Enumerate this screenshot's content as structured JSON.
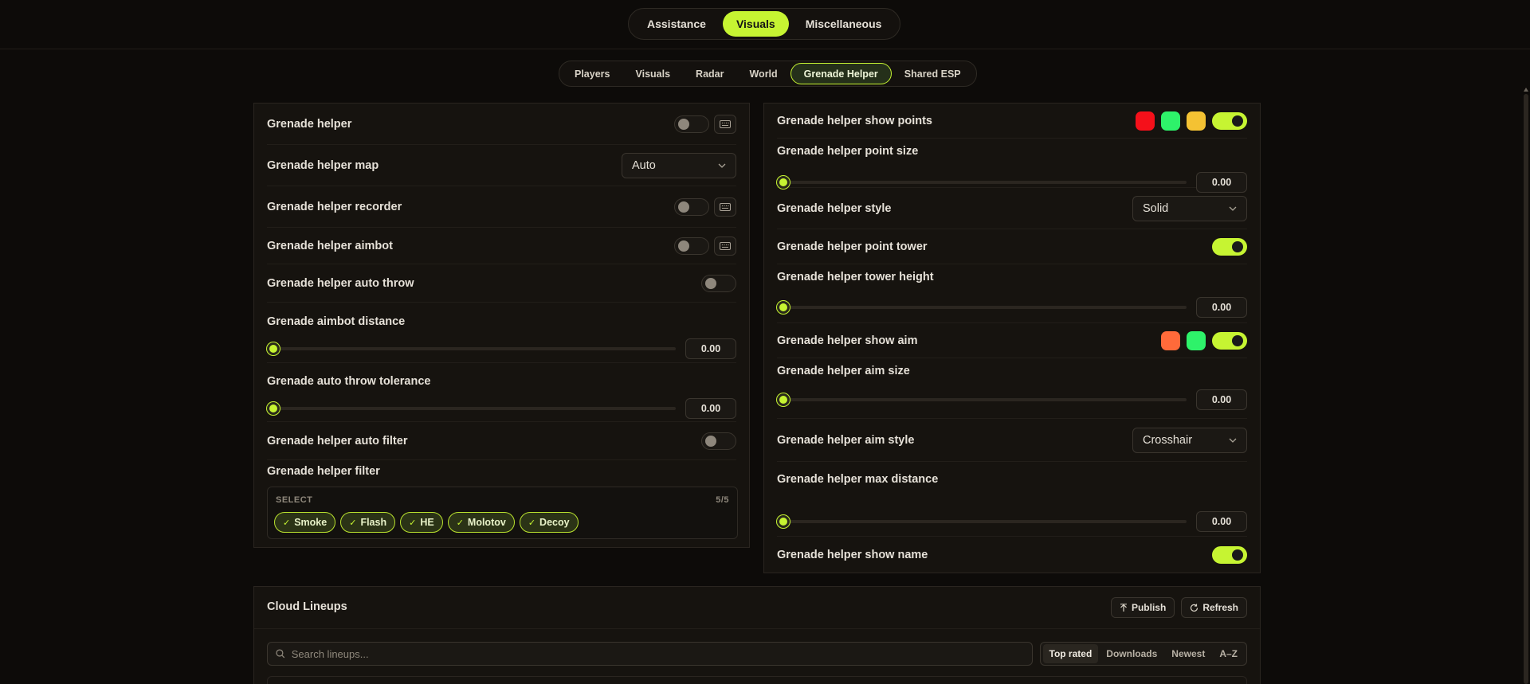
{
  "main_tabs": [
    {
      "label": "Assistance",
      "active": false
    },
    {
      "label": "Visuals",
      "active": true
    },
    {
      "label": "Miscellaneous",
      "active": false
    }
  ],
  "sub_tabs": [
    {
      "label": "Players",
      "active": false
    },
    {
      "label": "Visuals",
      "active": false
    },
    {
      "label": "Radar",
      "active": false
    },
    {
      "label": "World",
      "active": false
    },
    {
      "label": "Grenade Helper",
      "active": true
    },
    {
      "label": "Shared ESP",
      "active": false
    }
  ],
  "left": {
    "helper": {
      "label": "Grenade helper",
      "on": false
    },
    "map": {
      "label": "Grenade helper map",
      "value": "Auto"
    },
    "recorder": {
      "label": "Grenade helper recorder",
      "on": false
    },
    "aimbot": {
      "label": "Grenade helper aimbot",
      "on": false
    },
    "auto_throw": {
      "label": "Grenade helper auto throw",
      "on": false
    },
    "aimbot_distance": {
      "label": "Grenade aimbot distance",
      "value": "0.00"
    },
    "throw_tolerance": {
      "label": "Grenade auto throw tolerance",
      "value": "0.00"
    },
    "auto_filter": {
      "label": "Grenade helper auto filter",
      "on": false
    },
    "filter": {
      "label": "Grenade helper filter",
      "select_label": "SELECT",
      "count": "5/5",
      "chips": [
        "Smoke",
        "Flash",
        "HE",
        "Molotov",
        "Decoy"
      ]
    }
  },
  "right": {
    "show_points": {
      "label": "Grenade helper show points",
      "on": true,
      "colors": [
        "#f5101a",
        "#2ef26a",
        "#f4c233"
      ]
    },
    "point_size": {
      "label": "Grenade helper point size",
      "value": "0.00"
    },
    "style": {
      "label": "Grenade helper style",
      "value": "Solid"
    },
    "point_tower": {
      "label": "Grenade helper point tower",
      "on": true
    },
    "tower_height": {
      "label": "Grenade helper tower height",
      "value": "0.00"
    },
    "show_aim": {
      "label": "Grenade helper show aim",
      "on": true,
      "colors": [
        "#ff6a3a",
        "#2ef26a"
      ]
    },
    "aim_size": {
      "label": "Grenade helper aim size",
      "value": "0.00"
    },
    "aim_style": {
      "label": "Grenade helper aim style",
      "value": "Crosshair"
    },
    "max_distance": {
      "label": "Grenade helper max distance",
      "value": "0.00"
    },
    "show_name": {
      "label": "Grenade helper show name",
      "on": true
    }
  },
  "cloud": {
    "title": "Cloud Lineups",
    "publish": "Publish",
    "refresh": "Refresh",
    "search_placeholder": "Search lineups...",
    "sort_tabs": [
      {
        "label": "Top rated",
        "active": true
      },
      {
        "label": "Downloads",
        "active": false
      },
      {
        "label": "Newest",
        "active": false
      },
      {
        "label": "A–Z",
        "active": false
      }
    ]
  },
  "colors": {
    "accent": "#c6f432",
    "background": "#0d0b09",
    "panel": "#16130f"
  }
}
